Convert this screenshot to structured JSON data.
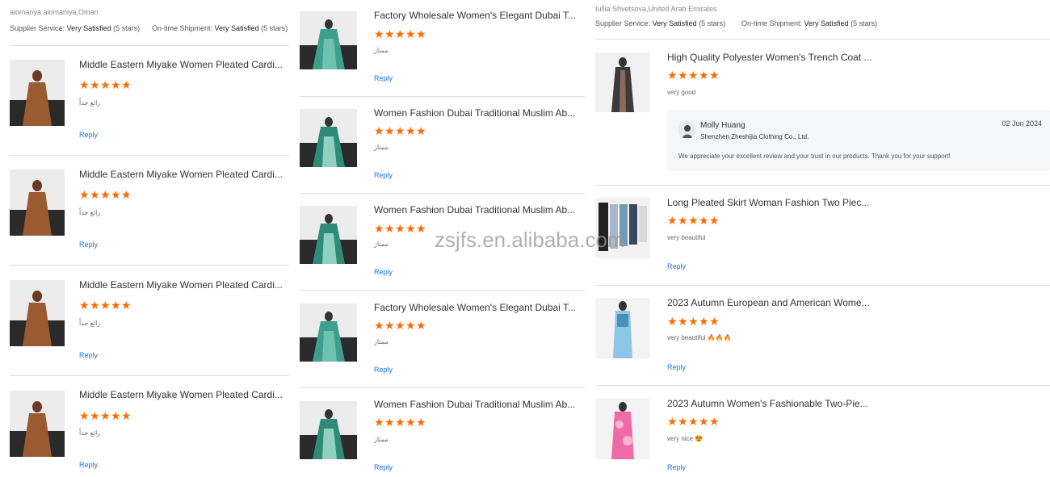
{
  "col1": {
    "reviewer": "alomanya alomaniya,Oman",
    "supplier_service_label": "Supplier Service:",
    "supplier_service_value": "Very Satisfied",
    "supplier_service_stars": "(5 stars)",
    "shipment_label": "On-time Shipment:",
    "shipment_value": "Very Satisfied",
    "shipment_stars": "(5 stars)",
    "items": [
      {
        "title": "Middle Eastern Miyake Women Pleated Cardi...",
        "comment": "رائع جداً",
        "reply": "Reply",
        "rating": 5
      },
      {
        "title": "Middle Eastern Miyake Women Pleated Cardi...",
        "comment": "رائع جداً",
        "reply": "Reply",
        "rating": 5
      },
      {
        "title": "Middle Eastern Miyake Women Pleated Cardi...",
        "comment": "رائع جداً",
        "reply": "Reply",
        "rating": 5
      },
      {
        "title": "Middle Eastern Miyake Women Pleated Cardi...",
        "comment": "رائع جداً",
        "reply": "Reply",
        "rating": 5
      }
    ]
  },
  "col2": {
    "items": [
      {
        "title": "Factory Wholesale Women's Elegant Dubai T...",
        "comment": "ممتاز",
        "reply": "Reply",
        "rating": 5
      },
      {
        "title": "Women Fashion Dubai Traditional Muslim Ab...",
        "comment": "ممتاز",
        "reply": "Reply",
        "rating": 5
      },
      {
        "title": "Women Fashion Dubai Traditional Muslim Ab...",
        "comment": "ممتاز",
        "reply": "Reply",
        "rating": 5
      },
      {
        "title": "Factory Wholesale Women's Elegant Dubai T...",
        "comment": "ممتاز",
        "reply": "Reply",
        "rating": 5
      },
      {
        "title": "Women Fashion Dubai Traditional Muslim Ab...",
        "comment": "ممتاز",
        "reply": "Reply",
        "rating": 5
      }
    ]
  },
  "col3": {
    "reviewer": "Iullia Shvetsova,United Arab Emirates",
    "supplier_service_label": "Supplier Service:",
    "supplier_service_value": "Very Satisfied",
    "supplier_service_stars": "(5 stars)",
    "shipment_label": "On-time Shipment:",
    "shipment_value": "Very Satisfied",
    "shipment_stars": "(5 stars)",
    "items": [
      {
        "title": "High Quality Polyester Women's Trench Coat ...",
        "comment": "very good",
        "rating": 5
      },
      {
        "title": "Long Pleated Skirt Woman Fashion Two Piec...",
        "comment": "very beautiful",
        "reply": "Reply",
        "rating": 5
      },
      {
        "title": "2023 Autumn European and American Wome...",
        "comment": "very beautiful 🔥🔥🔥",
        "reply": "Reply",
        "rating": 5
      },
      {
        "title": "2023 Autumn Women's Fashionable Two-Pie...",
        "comment": "very nice 😍",
        "reply": "Reply",
        "rating": 5
      }
    ],
    "supplier_reply": {
      "name": "Molly Huang",
      "company": "Shenzhen Zheshijia Clothing Co., Ltd.",
      "date": "02 Jun 2024",
      "text": "We appreciate your excellent review and your trust in our products. Thank you for your support!"
    }
  },
  "watermark": "zsjfs.en.alibaba.com",
  "colors": {
    "star": "#ff6a00",
    "link": "#1a73e8",
    "divider": "#dedede"
  }
}
